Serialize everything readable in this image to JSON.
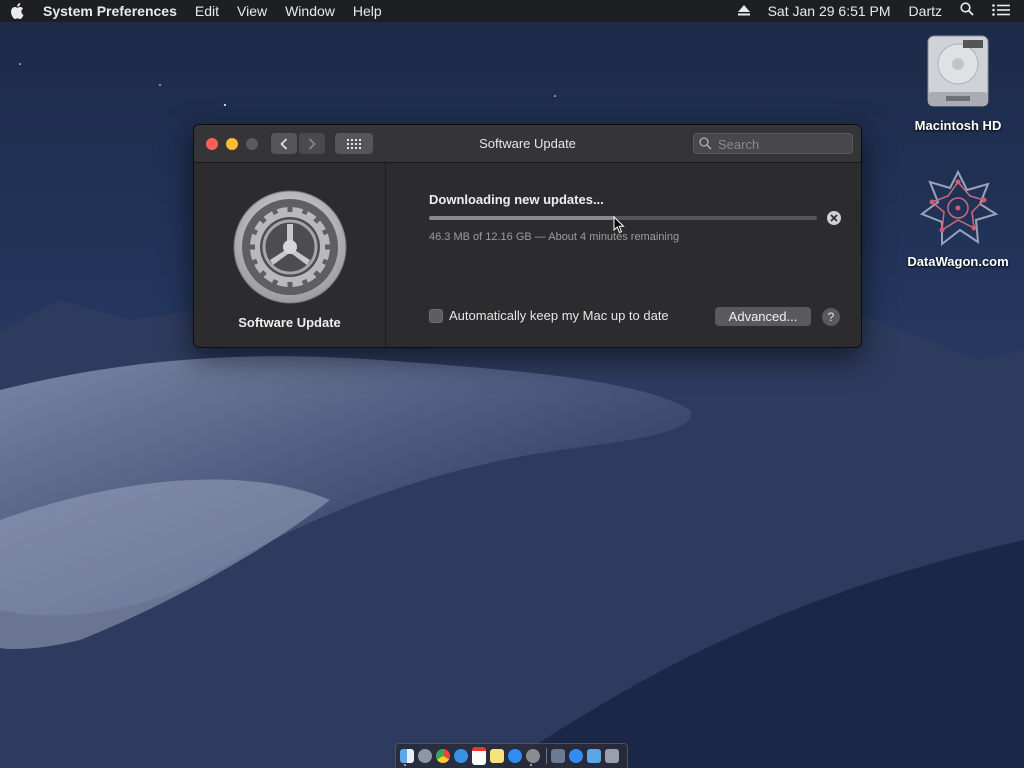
{
  "menubar": {
    "app_name": "System Preferences",
    "menus": [
      "Edit",
      "View",
      "Window",
      "Help"
    ],
    "datetime": "Sat Jan 29  6:51 PM",
    "user": "Dartz"
  },
  "desktop": {
    "icons": [
      {
        "label": "Macintosh HD",
        "icon": "hard-drive-icon"
      },
      {
        "label": "DataWagon.com",
        "icon": "star-network-icon"
      }
    ]
  },
  "window": {
    "title": "Software Update",
    "search_placeholder": "Search",
    "sidebar_label": "Software Update",
    "download": {
      "title": "Downloading new updates...",
      "status": "46.3 MB of 12.16 GB — About 4 minutes remaining",
      "progress_percent": 48
    },
    "auto_update": {
      "label": "Automatically keep my Mac up to date",
      "checked": false
    },
    "advanced_label": "Advanced...",
    "help_label": "?"
  },
  "colors": {
    "close": "#ff5f57",
    "minimize": "#febc2e",
    "zoom_disabled": "#5a5a5d"
  },
  "dock": {
    "apps": [
      "finder-icon",
      "launchpad-icon",
      "chrome-icon",
      "safari-icon",
      "calendar-icon",
      "notes-icon",
      "app-store-icon",
      "system-preferences-icon",
      "downloads-icon",
      "app-store-icon",
      "folder-icon",
      "trash-icon"
    ]
  }
}
